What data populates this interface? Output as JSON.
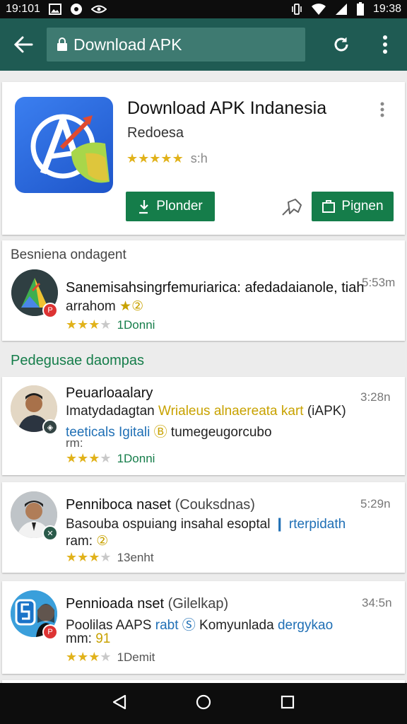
{
  "status_bar": {
    "left_time": "19:101",
    "right_time": "19:38"
  },
  "toolbar": {
    "url_text": "Download APK"
  },
  "app": {
    "title": "Download APK Indanesia",
    "developer": "Redoesa",
    "rating_stars": 5,
    "rating_text": "s:h",
    "install_button": "Plonder",
    "open_button": "Pignen"
  },
  "sections": {
    "featured_header": "Besniena ondagent",
    "reviews_header": "Pedegusae daompas"
  },
  "featured": {
    "name": "Sanemisahsingrfemuriarica: afedadaianole, tiah",
    "line2_text": "arrahom",
    "line2_icon": "★②",
    "stars": 3,
    "count": "1Donni",
    "time": "5:53m"
  },
  "reviews": [
    {
      "name": "Peuarloaalary",
      "line1_plain": "Imatydadagtan ",
      "line1_hl": "Wrialeus alnaereata kart",
      "line1_end": " (iAPK)",
      "line2_hl": "teeticals Igitali",
      "line2_icon": "Ⓑ",
      "line2_end": " tumegeugorcubo",
      "line3": "rm:",
      "stars": 3,
      "count": "1Donni",
      "time": "3:28n"
    },
    {
      "name": "Penniboca naset",
      "name_extra": " (Couksdnas)",
      "line1_plain": "Basouba ospuiang insahal esoptal ",
      "line1_hl": "❙ rterpidath",
      "line2": "ram: ",
      "line2_icon": "②",
      "stars": 3,
      "count": "13enht",
      "time": "5:29n"
    },
    {
      "name": "Pennioada nset",
      "name_extra": " (Gilelkap)",
      "line1_plain": "Poolilas AAPS ",
      "line1_hl": "rabt Ⓢ",
      "line1_end": " Komyunlada ",
      "line1_hl2": "dergykao",
      "line2": "mm: ",
      "line2_icon": "91",
      "stars": 3,
      "count": "1Demit",
      "time": "34:5n"
    }
  ],
  "colors": {
    "toolbar": "#1f5b53",
    "accent_green": "#157d4a",
    "star": "#e1b21a"
  },
  "icons": [
    "back-arrow-icon",
    "lock-icon",
    "refresh-icon",
    "more-vert-icon",
    "pin-icon",
    "open-icon",
    "back-nav-icon",
    "home-nav-icon",
    "recents-nav-icon"
  ]
}
